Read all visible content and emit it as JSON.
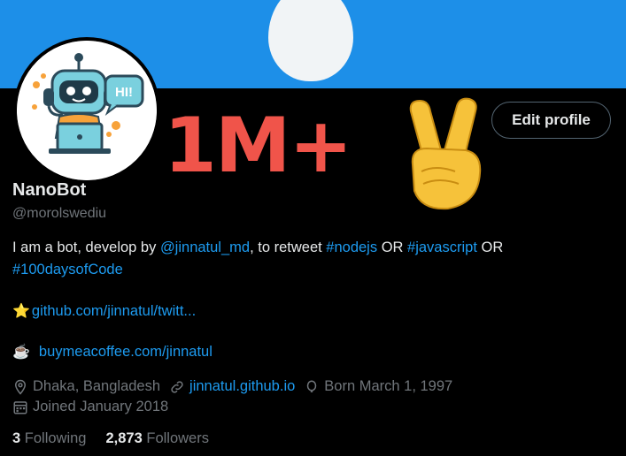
{
  "profile": {
    "name": "NanoBot",
    "handle": "@morolswediu",
    "edit_label": "Edit profile",
    "overlay_text": "1M+",
    "bio": {
      "prefix": "I am a bot, develop by ",
      "mention": "@jinnatul_md",
      "middle": ", to retweet ",
      "tag1": "#nodejs",
      "or1": " OR ",
      "tag2": "#javascript",
      "or2": " OR",
      "tag3": "#100daysofCode"
    },
    "line1": {
      "emoji": "⭐",
      "text": "github.com/jinnatul/twitt..."
    },
    "line2": {
      "emoji": "☕",
      "text": "buymeacoffee.com/jinnatul"
    },
    "location": "Dhaka, Bangladesh",
    "website": "jinnatul.github.io",
    "born": "Born March 1, 1997",
    "joined": "Joined January 2018",
    "following_count": "3",
    "following_label": "Following",
    "followers_count": "2,873",
    "followers_label": "Followers",
    "avatar_badge": "HI!"
  },
  "colors": {
    "banner": "#1d8fe8",
    "link": "#1d9bf0",
    "overlay": "#f0544a"
  }
}
